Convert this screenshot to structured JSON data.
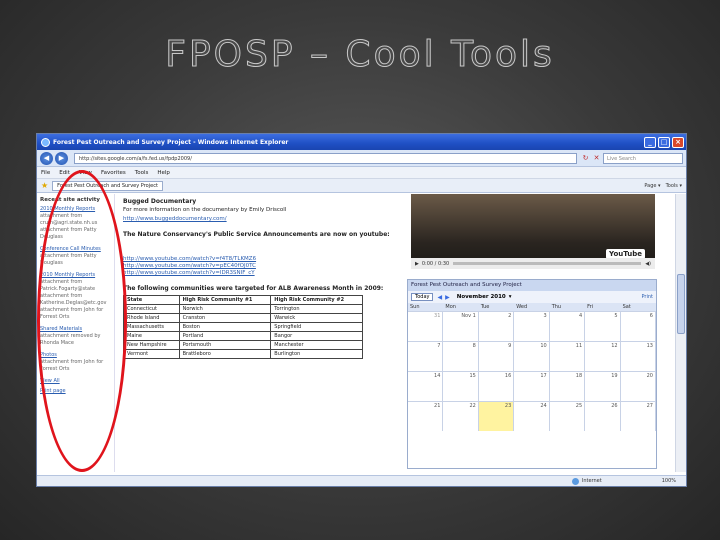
{
  "slide": {
    "title": "FPOSP – Cool Tools"
  },
  "browser": {
    "window_title": "Forest Pest Outreach and Survey Project - Windows Internet Explorer",
    "url": "http://sites.google.com/a/fs.fed.us/fpdp2009/",
    "search_placeholder": "Live Search",
    "menu": [
      "File",
      "Edit",
      "View",
      "Favorites",
      "Tools",
      "Help"
    ],
    "tab_label": "Forest Pest Outreach and Survey Project",
    "toolbar_items": [
      "Page ▾",
      "Tools ▾"
    ],
    "status_zone": "Internet",
    "status_zoom": "100%"
  },
  "sidebar": {
    "heading": "Recent site activity",
    "items": [
      {
        "link": "2010 Monthly Reports",
        "meta": "attachment from cruth@agri.state.nh.us attachment from Patty Douglass"
      },
      {
        "link": "Conference Call Minutes",
        "meta": "attachment from Patty Douglass"
      },
      {
        "link": "2010 Monthly Reports",
        "meta": "attachment from Patrick.Fogarty@state attachment from Katherine.Deglas@etc.gov attachment from John for Forrest Orts"
      },
      {
        "link": "Shared Materials",
        "meta": "attachment removed by Rhonda Mace"
      },
      {
        "link": "Photos",
        "meta": "attachment from John for Forrest Orts"
      }
    ],
    "view_all": "View All",
    "print_link": "Print page"
  },
  "main": {
    "block1_title": "Bugged Documentary",
    "block1_text": "For more information on the documentary by Emily Driscoll",
    "block1_link": "http://www.buggeddocumentary.com/",
    "block2_title": "The Nature Conservancy's Public Service Announcements are now on youtube:",
    "youtube_links": [
      "http://www.youtube.com/watch?v=f4T8/TLKMZ6",
      "http://www.youtube.com/watch?v=pEC40fOJ0TC",
      "http://www.youtube.com/watch?v=IDR3SNIF_cY"
    ],
    "block3_title": "The following communities were targeted for ALB Awareness Month in 2009:",
    "table_headers": [
      "State",
      "High Risk Community #1",
      "High Risk Community #2"
    ],
    "table_rows": [
      [
        "Connecticut",
        "Norwich",
        "Torrington"
      ],
      [
        "Rhode Island",
        "Cranston",
        "Warwick"
      ],
      [
        "Massachusetts",
        "Boston",
        "Springfield"
      ],
      [
        "Maine",
        "Portland",
        "Bangor"
      ],
      [
        "New Hampshire",
        "Portsmouth",
        "Manchester"
      ],
      [
        "Vermont",
        "Brattleboro",
        "Burlington"
      ]
    ]
  },
  "video": {
    "brand": "YouTube",
    "time": "0:00 / 0:30"
  },
  "calendar": {
    "title": "Forest Pest Outreach and Survey Project",
    "today_button": "Today",
    "month": "November 2010",
    "print": "Print",
    "days_of_week": [
      "Sun",
      "Mon",
      "Tue",
      "Wed",
      "Thu",
      "Fri",
      "Sat"
    ],
    "weeks": [
      [
        "31",
        "Nov 1",
        "2",
        "3",
        "4",
        "5",
        "6"
      ],
      [
        "7",
        "8",
        "9",
        "10",
        "11",
        "12",
        "13"
      ],
      [
        "14",
        "15",
        "16",
        "17",
        "18",
        "19",
        "20"
      ],
      [
        "21",
        "22",
        "23",
        "24",
        "25",
        "26",
        "27"
      ]
    ],
    "today_cell": "23"
  },
  "colors": {
    "highlight": "#e0141c",
    "titlebar": "#1f4fc4",
    "link": "#2a5db0"
  }
}
